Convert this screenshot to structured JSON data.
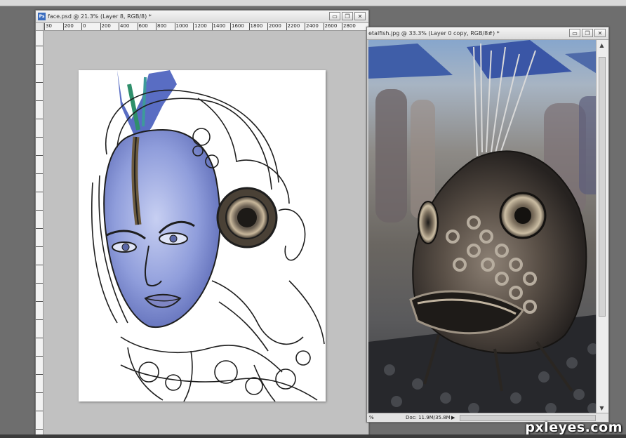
{
  "window_a": {
    "title": "face.psd @ 21.3% (Layer 8, RGB/8) *",
    "app_icon": "Ps",
    "ruler_labels": [
      "30",
      "200",
      "0",
      "200",
      "400",
      "600",
      "800",
      "1000",
      "1200",
      "1400",
      "1600",
      "1800",
      "2000",
      "2200",
      "2400",
      "2600",
      "2800"
    ],
    "buttons": {
      "minimize": "▭",
      "restore": "❐",
      "close": "✕"
    }
  },
  "window_b": {
    "title": "etalfish.jpg @ 33.3% (Layer 0 copy, RGB/8#) *",
    "buttons": {
      "minimize": "▭",
      "restore": "❐",
      "close": "✕"
    },
    "status": {
      "zoom": "%",
      "doc": "Doc: 11.9M/35.8M",
      "arrow": "▶"
    },
    "scroll_up": "▲",
    "scroll_down": "▼"
  },
  "watermark": "pxleyes.com",
  "icons": [
    "ps-app-icon",
    "minimize-icon",
    "restore-icon",
    "close-icon",
    "scroll-up-icon",
    "scroll-down-icon"
  ],
  "colors": {
    "workspace": "#6e6e6e",
    "canvas": "#c1c1c1",
    "skin": "#8a98d6",
    "ink": "#1e1e1e"
  }
}
